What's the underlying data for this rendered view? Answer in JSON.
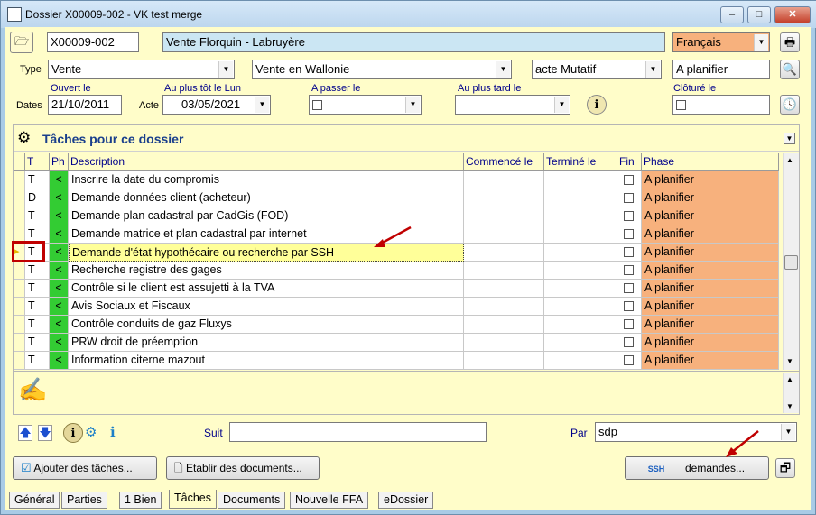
{
  "window": {
    "title": "Dossier X00009-002 - VK test merge"
  },
  "header": {
    "dossier_id": "X00009-002",
    "dossier_name": "Vente Florquin - Labruyère",
    "language": "Français",
    "type_label": "Type",
    "type1": "Vente",
    "type2": "Vente en Wallonie",
    "type3": "acte Mutatif",
    "status": "A planifier",
    "dates_label": "Dates",
    "opened_label": "Ouvert le",
    "opened_value": "21/10/2011",
    "acte_label": "Acte",
    "earliest_label": "Au plus tôt le Lun",
    "earliest_value": "03/05/2021",
    "topass_label": "A passer le",
    "latest_label": "Au plus tard le",
    "closed_label": "Clôturé le"
  },
  "tasks": {
    "title": "Tâches pour ce dossier",
    "columns": [
      "T",
      "Ph",
      "Description",
      "Commencé le",
      "Terminé le",
      "Fin",
      "Phase"
    ],
    "rows": [
      {
        "t": "T",
        "ph": "<",
        "desc": "Inscrire la date du compromis",
        "phase": "A planifier"
      },
      {
        "t": "D",
        "ph": "<",
        "desc": "Demande données client (acheteur)",
        "phase": "A planifier"
      },
      {
        "t": "T",
        "ph": "<",
        "desc": "Demande plan cadastral par CadGis (FOD)",
        "phase": "A planifier"
      },
      {
        "t": "T",
        "ph": "<",
        "desc": "Demande matrice et plan cadastral par internet",
        "phase": "A planifier"
      },
      {
        "t": "T",
        "ph": "<",
        "desc": "Demande d'état hypothécaire ou recherche par SSH",
        "phase": "A planifier"
      },
      {
        "t": "T",
        "ph": "<",
        "desc": "Recherche registre des gages",
        "phase": "A planifier"
      },
      {
        "t": "T",
        "ph": "<",
        "desc": "Contrôle si le client est assujetti à la TVA",
        "phase": "A planifier"
      },
      {
        "t": "T",
        "ph": "<",
        "desc": "Avis Sociaux et Fiscaux",
        "phase": "A planifier"
      },
      {
        "t": "T",
        "ph": "<",
        "desc": "Contrôle conduits de gaz Fluxys",
        "phase": "A planifier"
      },
      {
        "t": "T",
        "ph": "<",
        "desc": "PRW droit de préemption",
        "phase": "A planifier"
      },
      {
        "t": "T",
        "ph": "<",
        "desc": "Information citerne mazout",
        "phase": "A planifier"
      }
    ]
  },
  "footer": {
    "suit_label": "Suit",
    "par_label": "Par",
    "par_value": "sdp",
    "add_tasks": "Ajouter des tâches...",
    "make_docs": "Etablir des documents...",
    "ssh_icon_text": "SSH",
    "requests": "demandes..."
  },
  "tabs": [
    "Général",
    "Parties",
    "1 Bien",
    "Tâches",
    "Documents",
    "Nouvelle FFA",
    "eDossier"
  ],
  "colors": {
    "accent": "#fffdc9",
    "phase": "#f7b17d",
    "ph": "#33cc33",
    "highlight": "#ffff99"
  }
}
